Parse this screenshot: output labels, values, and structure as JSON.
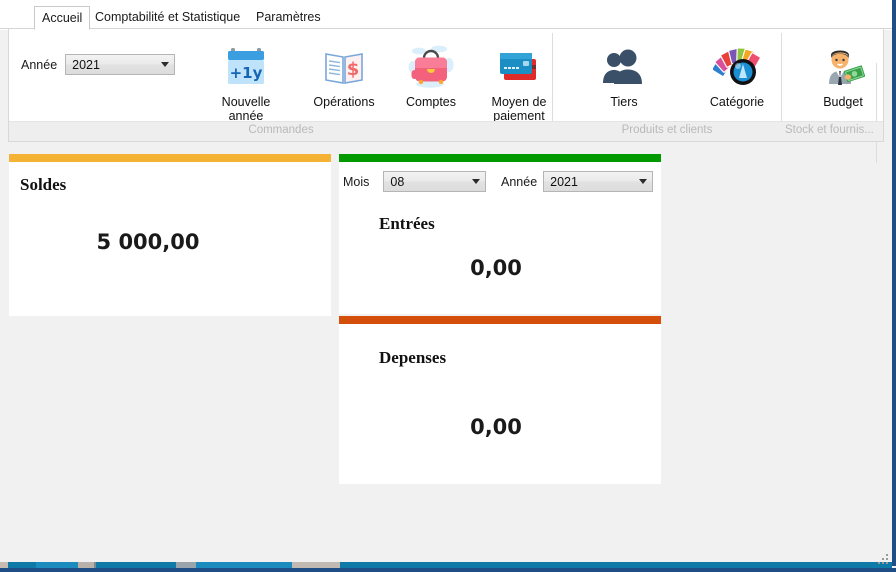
{
  "window": {
    "frame_color": "#1f4e87"
  },
  "tabs": [
    {
      "label": "Accueil",
      "active": true
    },
    {
      "label": "Comptabilité et Statistique",
      "active": false
    },
    {
      "label": "Paramètres",
      "active": false
    }
  ],
  "ribbon": {
    "year_field": {
      "label": "Année",
      "value": "2021"
    },
    "buttons": [
      {
        "name": "nouvelle-annee",
        "caption": "Nouvelle\nannée",
        "icon": "calendar-plus-1y-icon",
        "badge": "+1y"
      },
      {
        "name": "operations",
        "caption": "Opérations",
        "icon": "ledger-dollar-icon"
      },
      {
        "name": "comptes",
        "caption": "Comptes",
        "icon": "briefcase-icon"
      },
      {
        "name": "moyen-de-paiement",
        "caption": "Moyen de\npaiement",
        "icon": "credit-cards-icon"
      },
      {
        "name": "tiers",
        "caption": "Tiers",
        "icon": "people-icon"
      },
      {
        "name": "categorie",
        "caption": "Catégorie",
        "icon": "color-fan-lens-icon"
      },
      {
        "name": "budget",
        "caption": "Budget",
        "icon": "businessman-money-icon"
      }
    ],
    "groups": [
      {
        "label": "Commandes"
      },
      {
        "label": "Produits et clients"
      },
      {
        "label": "Stock et fournis..."
      }
    ]
  },
  "dashboard": {
    "soldes": {
      "title": "Soldes",
      "amount": "5 000,00",
      "accent": "#f5b335"
    },
    "entrees": {
      "title": "Entrées",
      "amount": "0,00",
      "accent": "#009900",
      "month_field": {
        "label": "Mois",
        "value": "08"
      },
      "year_field": {
        "label": "Année",
        "value": "2021"
      }
    },
    "depenses": {
      "title": "Depenses",
      "amount": "0,00",
      "accent": "#d4500a"
    }
  }
}
